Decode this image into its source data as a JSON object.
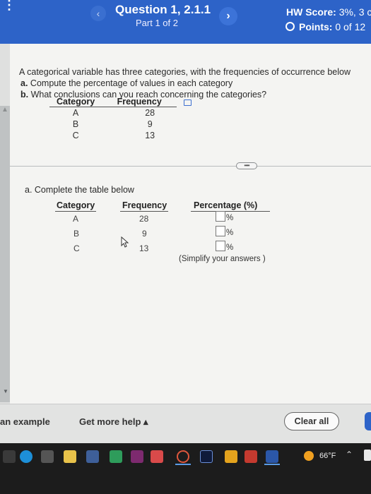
{
  "header": {
    "question_title": "Question 1, 2.1.1",
    "part": "Part 1 of 2",
    "hw_score_label": "HW Score:",
    "hw_score_value": "3%, 3 c",
    "points_label": "Points:",
    "points_value": "0 of 12"
  },
  "problem": {
    "intro": "A categorical variable has three categories, with the frequencies of occurrence below",
    "part_a_label": "a.",
    "part_a_text": "Compute the percentage of values in each category",
    "part_b_label": "b.",
    "part_b_text": "What conclusions can you reach concerning the categories?",
    "table_headers": [
      "Category",
      "Frequency"
    ],
    "rows": [
      {
        "category": "A",
        "frequency": "28"
      },
      {
        "category": "B",
        "frequency": "9"
      },
      {
        "category": "C",
        "frequency": "13"
      }
    ]
  },
  "answer": {
    "instruction": "a. Complete the table below",
    "headers": [
      "Category",
      "Frequency",
      "Percentage (%)"
    ],
    "rows": [
      {
        "category": "A",
        "frequency": "28",
        "unit": "%"
      },
      {
        "category": "B",
        "frequency": "9",
        "unit": "%"
      },
      {
        "category": "C",
        "frequency": "13",
        "unit": "%"
      }
    ],
    "hint": "(Simplify your answers )"
  },
  "expand_button": "••••",
  "footer": {
    "example_label": "an example",
    "help_label": "Get more help ▴",
    "clear_all_label": "Clear all"
  },
  "taskbar": {
    "temperature": "66°F"
  },
  "colors": {
    "header_blue": "#2d63c8",
    "panel_bg": "#f4f4f2",
    "taskbar": "#1c1c1c"
  }
}
